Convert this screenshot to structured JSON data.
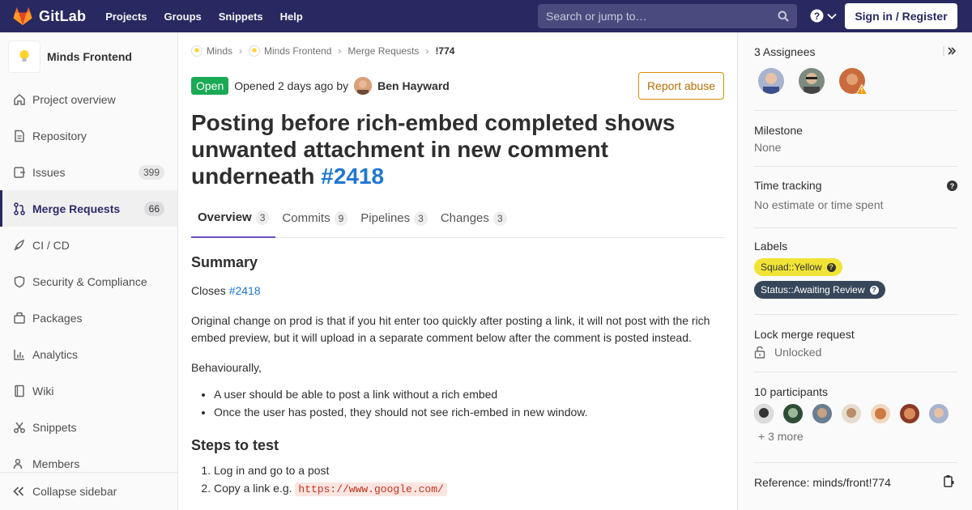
{
  "colors": {
    "navbar": "#292961",
    "open_badge": "#1aaa55",
    "link": "#1f78d1",
    "report": "#db8c00",
    "label_squad": "#f1e436",
    "label_status": "#36475a",
    "tab_active_underline": "#6b4fbb"
  },
  "navbar": {
    "brand": "GitLab",
    "links": [
      "Projects",
      "Groups",
      "Snippets",
      "Help"
    ],
    "search_placeholder": "Search or jump to…",
    "signin": "Sign in / Register"
  },
  "sidebar": {
    "project_name": "Minds Frontend",
    "items": [
      {
        "label": "Project overview",
        "icon": "home-icon"
      },
      {
        "label": "Repository",
        "icon": "doc-icon"
      },
      {
        "label": "Issues",
        "icon": "issues-icon",
        "count": "399"
      },
      {
        "label": "Merge Requests",
        "icon": "merge-request-icon",
        "count": "66",
        "active": true
      },
      {
        "label": "CI / CD",
        "icon": "rocket-icon"
      },
      {
        "label": "Security & Compliance",
        "icon": "shield-icon"
      },
      {
        "label": "Packages",
        "icon": "package-icon"
      },
      {
        "label": "Analytics",
        "icon": "chart-icon"
      },
      {
        "label": "Wiki",
        "icon": "book-icon"
      },
      {
        "label": "Snippets",
        "icon": "scissors-icon"
      },
      {
        "label": "Members",
        "icon": "users-icon"
      }
    ],
    "collapse": "Collapse sidebar"
  },
  "breadcrumb": [
    "Minds",
    "Minds Frontend",
    "Merge Requests",
    "!774"
  ],
  "mr": {
    "status": "Open",
    "opened": "Opened 2 days ago by",
    "author": "Ben Hayward",
    "report": "Report abuse",
    "title": "Posting before rich-embed completed shows unwanted attachment in new comment underneath",
    "issue_ref": "#2418"
  },
  "tabs": [
    {
      "label": "Overview",
      "count": "3"
    },
    {
      "label": "Commits",
      "count": "9"
    },
    {
      "label": "Pipelines",
      "count": "3"
    },
    {
      "label": "Changes",
      "count": "3"
    }
  ],
  "description": {
    "summary_heading": "Summary",
    "closes_text": "Closes",
    "closes_ref": "#2418",
    "para1": "Original change on prod is that if you hit enter too quickly after posting a link, it will not post with the rich embed preview, but it will upload in a separate comment below after the comment is posted instead.",
    "para2": "Behaviourally,",
    "bullets": [
      "A user should be able to post a link without a rich embed",
      "Once the user has posted, they should not see rich-embed in new window."
    ],
    "steps_heading": "Steps to test",
    "step1": "Log in and go to a post",
    "step2_text": "Copy a link e.g.",
    "step2_code": "https://www.google.com/"
  },
  "right": {
    "assignees_title": "3 Assignees",
    "milestone_title": "Milestone",
    "milestone_value": "None",
    "time_title": "Time tracking",
    "time_value": "No estimate or time spent",
    "labels_title": "Labels",
    "label1": "Squad::Yellow",
    "label2": "Status::Awaiting Review",
    "lock_title": "Lock merge request",
    "lock_value": "Unlocked",
    "participants_title": "10 participants",
    "more": "+ 3 more",
    "reference": "Reference: minds/front!774"
  }
}
